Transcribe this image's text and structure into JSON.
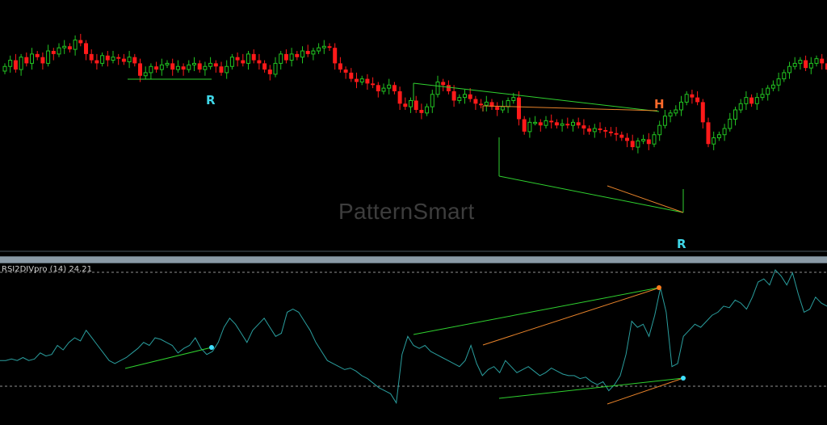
{
  "watermark": "PatternSmart",
  "indicator": {
    "name": "RSI2DIVpro",
    "period_text": "(14)",
    "value_text": "24.21"
  },
  "pattern_labels": [
    {
      "text": "R",
      "color": "#3fd7e8"
    },
    {
      "text": "H",
      "color": "#ff6a2b"
    },
    {
      "text": "R",
      "color": "#3fd7e8"
    }
  ],
  "colors": {
    "bull": "#22c422",
    "bear": "#ff1a1a",
    "rsi_line": "#2a9e9e",
    "div_green": "#2fd12f",
    "div_orange": "#e8832a",
    "level_line": "#cccccc",
    "cyan_dot": "#3fe0ff",
    "orange_dot": "#ff7a1a"
  },
  "chart_data": [
    {
      "type": "candlestick",
      "title": "",
      "candles_count": 150,
      "ohlc_ylim": [
        0,
        100
      ],
      "close": [
        78,
        82,
        76,
        84,
        80,
        86,
        84,
        80,
        88,
        86,
        90,
        91,
        89,
        95,
        93,
        86,
        82,
        80,
        85,
        82,
        84,
        83,
        81,
        84,
        80,
        72,
        74,
        78,
        76,
        79,
        80,
        76,
        78,
        76,
        79,
        80,
        76,
        78,
        80,
        78,
        74,
        78,
        84,
        82,
        80,
        86,
        82,
        80,
        76,
        73,
        80,
        86,
        82,
        86,
        84,
        88,
        86,
        88,
        90,
        91,
        90,
        80,
        76,
        74,
        70,
        68,
        70,
        67,
        66,
        62,
        64,
        66,
        62,
        54,
        52,
        56,
        50,
        48,
        52,
        60,
        68,
        66,
        62,
        56,
        58,
        60,
        57,
        54,
        53,
        55,
        52,
        50,
        52,
        56,
        58,
        44,
        36,
        42,
        42,
        40,
        43,
        42,
        40,
        41,
        40,
        42,
        40,
        38,
        36,
        38,
        37,
        36,
        35,
        34,
        32,
        30,
        26,
        30,
        31,
        28,
        34,
        40,
        46,
        48,
        50,
        55,
        60,
        58,
        55,
        42,
        28,
        32,
        34,
        38,
        44,
        50,
        54,
        58,
        54,
        58,
        60,
        64,
        66,
        70,
        74,
        78,
        80,
        82,
        77,
        80,
        83,
        80,
        76,
        70,
        68,
        72,
        74,
        77
      ]
    },
    {
      "type": "line",
      "title": "",
      "series": [
        {
          "values": [
            40,
            40,
            41,
            40,
            42,
            40,
            41,
            45,
            43,
            44,
            50,
            47,
            52,
            55,
            53,
            60,
            55,
            50,
            45,
            40,
            38,
            40,
            42,
            45,
            48,
            52,
            50,
            55,
            54,
            52,
            50,
            45,
            48,
            50,
            55,
            48,
            44,
            46,
            52,
            62,
            68,
            64,
            58,
            52,
            60,
            64,
            68,
            62,
            56,
            58,
            72,
            74,
            72,
            66,
            60,
            52,
            46,
            40,
            38,
            36,
            34,
            35,
            33,
            30,
            28,
            25,
            22,
            20,
            18,
            12,
            44,
            56,
            50,
            48,
            50,
            46,
            44,
            42,
            40,
            38,
            36,
            40,
            50,
            38,
            30,
            34,
            36,
            32,
            40,
            36,
            32,
            34,
            36,
            33,
            30,
            32,
            35,
            33,
            31,
            30,
            30,
            28,
            29,
            26,
            24,
            26,
            20,
            24,
            30,
            44,
            66,
            62,
            64,
            56,
            70,
            88,
            72,
            36,
            38,
            56,
            60,
            64,
            62,
            66,
            70,
            72,
            76,
            75,
            80,
            78,
            74,
            82,
            92,
            94,
            90,
            100,
            96,
            90,
            98,
            84,
            72,
            74,
            82,
            78,
            76
          ]
        }
      ],
      "ylim": [
        0,
        100
      ],
      "levels": [
        70,
        30
      ]
    }
  ]
}
